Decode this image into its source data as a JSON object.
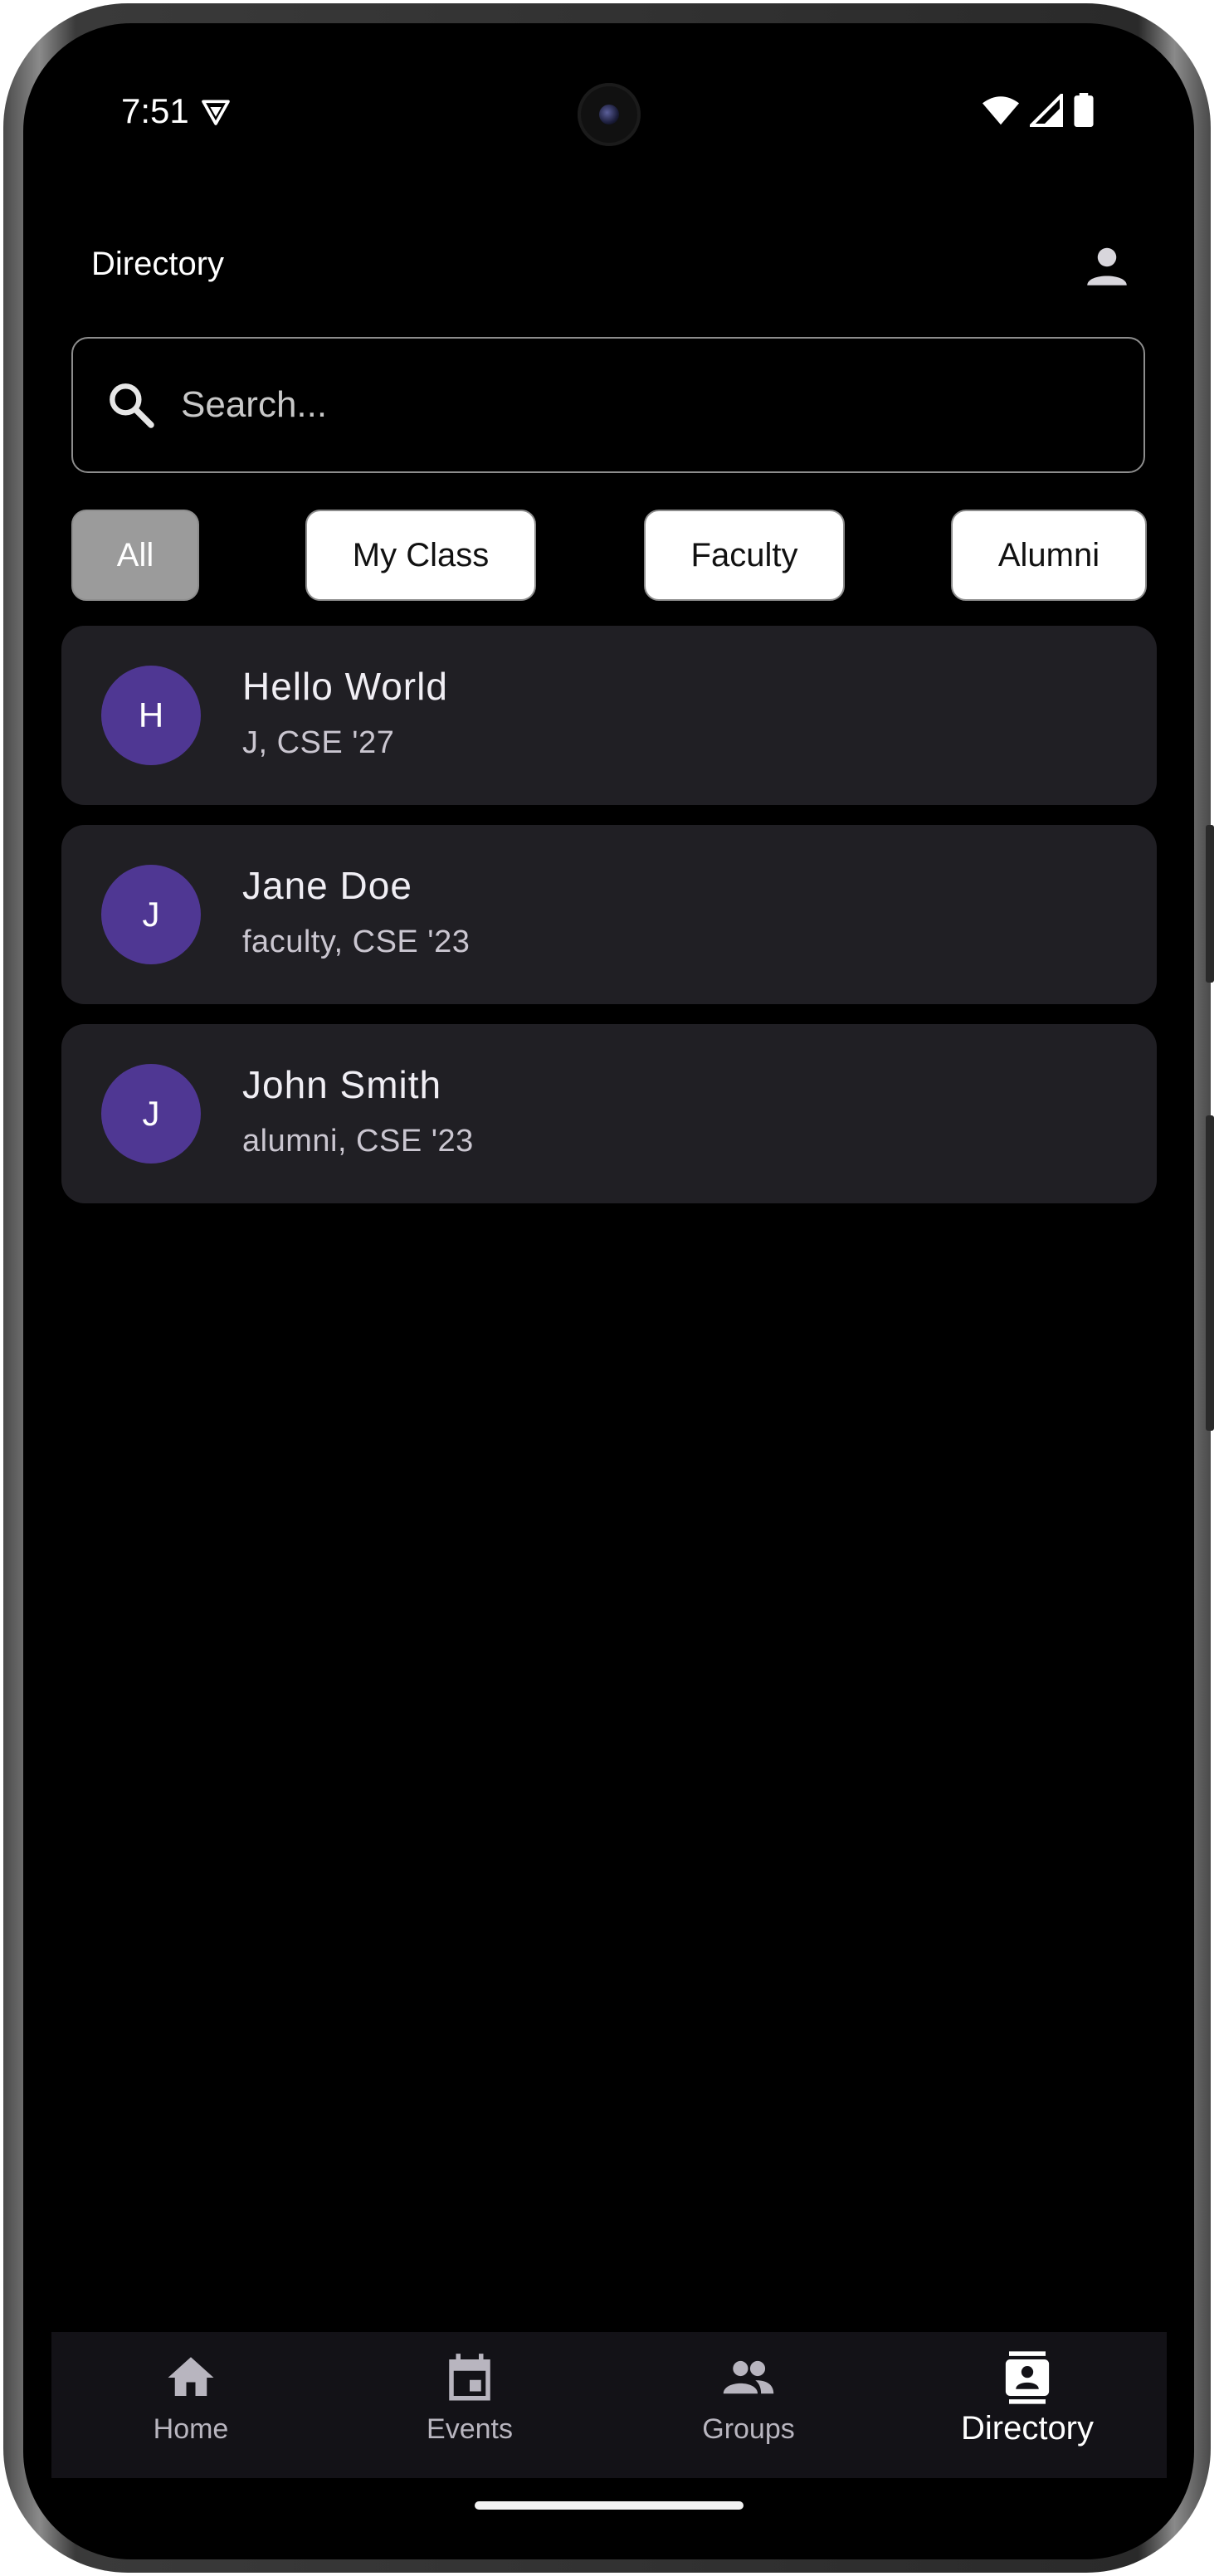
{
  "status_bar": {
    "time": "7:51",
    "icons": [
      "vpn-shield-icon",
      "wifi-icon",
      "cell-signal-icon",
      "battery-icon"
    ]
  },
  "header": {
    "title": "Directory",
    "profile_icon": "person-icon"
  },
  "search": {
    "placeholder": "Search...",
    "value": ""
  },
  "filters": [
    {
      "label": "All",
      "selected": true
    },
    {
      "label": "My Class",
      "selected": false
    },
    {
      "label": "Faculty",
      "selected": false
    },
    {
      "label": "Alumni",
      "selected": false
    }
  ],
  "people": [
    {
      "initial": "H",
      "name": "Hello World",
      "subtitle": "J, CSE '27"
    },
    {
      "initial": "J",
      "name": "Jane Doe",
      "subtitle": "faculty, CSE '23"
    },
    {
      "initial": "J",
      "name": "John Smith",
      "subtitle": "alumni, CSE '23"
    }
  ],
  "bottom_nav": {
    "active": "Directory",
    "items": [
      {
        "label": "Home",
        "icon": "home-icon"
      },
      {
        "label": "Events",
        "icon": "calendar-icon"
      },
      {
        "label": "Groups",
        "icon": "group-icon"
      },
      {
        "label": "Directory",
        "icon": "contact-card-icon"
      }
    ]
  },
  "colors": {
    "background": "#000000",
    "card": "#201f24",
    "avatar": "#4f3793",
    "chip_selected": "#9b9b9b",
    "nav_bar": "#131217"
  }
}
